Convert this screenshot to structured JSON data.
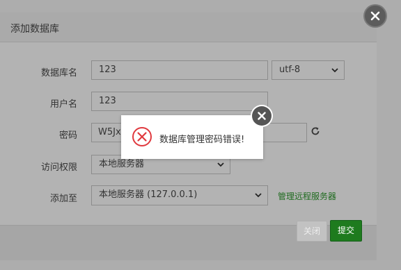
{
  "dialog": {
    "title": "添加数据库",
    "fields": {
      "db_name_label": "数据库名",
      "db_name_value": "123",
      "charset_value": "utf-8",
      "username_label": "用户名",
      "username_value": "123",
      "password_label": "密码",
      "password_value": "W5JxE",
      "access_label": "访问权限",
      "access_value": "本地服务器",
      "add_to_label": "添加至",
      "add_to_value": "本地服务器 (127.0.0.1)",
      "manage_remote_link": "管理远程服务器"
    },
    "footer": {
      "close_label": "关闭",
      "submit_label": "提交"
    }
  },
  "toast": {
    "message": "数据库管理密码错误!"
  },
  "icons": {
    "dialog_close": "close-icon",
    "toast_close": "close-icon",
    "toast_status": "error-circle-icon",
    "refresh": "refresh-icon",
    "select_arrow": "chevron-down-icon"
  },
  "colors": {
    "submit": "#1e7b1e",
    "link": "#1f6b1f",
    "error": "#e0393e"
  }
}
